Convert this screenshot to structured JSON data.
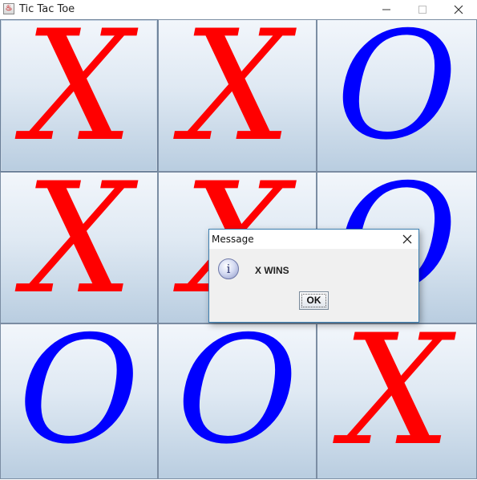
{
  "window": {
    "title": "Tic Tac Toe",
    "app_icon": "java-icon",
    "controls": [
      "minimize-icon",
      "maximize-icon",
      "close-icon"
    ]
  },
  "board": {
    "cells": [
      {
        "mark": "X",
        "pressed": true
      },
      {
        "mark": "X"
      },
      {
        "mark": "O"
      },
      {
        "mark": "X"
      },
      {
        "mark": "X"
      },
      {
        "mark": "O"
      },
      {
        "mark": "O"
      },
      {
        "mark": "O"
      },
      {
        "mark": "X"
      }
    ],
    "colors": {
      "x": "#ff0000",
      "o": "#0000ff"
    }
  },
  "dialog": {
    "title": "Message",
    "icon": "info-icon",
    "message": "X WINS",
    "ok_label": "OK"
  }
}
